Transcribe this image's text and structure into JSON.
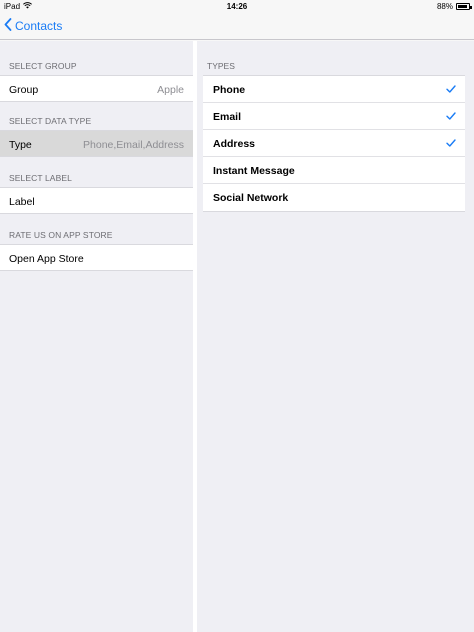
{
  "status_bar": {
    "device": "iPad",
    "time": "14:26",
    "battery": "88%",
    "battery_level": 0.88
  },
  "nav": {
    "back_label": "Contacts"
  },
  "left": {
    "sections": {
      "group": {
        "header": "SELECT GROUP",
        "row_label": "Group",
        "row_value": "Apple"
      },
      "data_type": {
        "header": "SELECT DATA TYPE",
        "row_label": "Type",
        "row_value": "Phone,Email,Address"
      },
      "label": {
        "header": "SELECT LABEL",
        "row_label": "Label"
      },
      "rate": {
        "header": "RATE US ON APP STORE",
        "row_label": "Open App Store"
      }
    }
  },
  "right": {
    "header": "TYPES",
    "items": [
      {
        "label": "Phone",
        "checked": true
      },
      {
        "label": "Email",
        "checked": true
      },
      {
        "label": "Address",
        "checked": true
      },
      {
        "label": "Instant Message",
        "checked": false
      },
      {
        "label": "Social Network",
        "checked": false
      }
    ]
  },
  "colors": {
    "accent": "#1a7cf5",
    "background": "#efeff4",
    "row_background": "#ffffff",
    "highlight": "#d9d9d9",
    "header_text": "#6d6d72",
    "value_text": "#8e8e93"
  },
  "icons": {
    "back": "chevron-left-icon",
    "wifi": "wifi-icon",
    "battery": "battery-icon",
    "check": "checkmark-icon"
  }
}
